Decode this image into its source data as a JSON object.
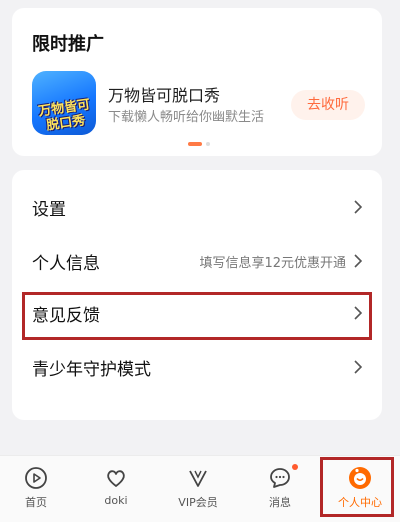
{
  "promo": {
    "title": "限时推广",
    "app_icon_text_1": "万物皆可",
    "app_icon_text_2": "脱口秀",
    "app_name": "万物皆可脱口秀",
    "app_desc": "下载懒人畅听给你幽默生活",
    "button": "去收听"
  },
  "menu": {
    "items": [
      {
        "label": "设置",
        "hint": ""
      },
      {
        "label": "个人信息",
        "hint": "填写信息享12元优惠开通"
      },
      {
        "label": "意见反馈",
        "hint": ""
      },
      {
        "label": "青少年守护模式",
        "hint": ""
      }
    ]
  },
  "tabbar": {
    "tabs": [
      {
        "label": "首页",
        "icon": "play-icon"
      },
      {
        "label": "doki",
        "icon": "heart-bubble-icon"
      },
      {
        "label": "VIP会员",
        "icon": "vip-v-icon"
      },
      {
        "label": "消息",
        "icon": "chat-bubble-icon",
        "badge": true
      },
      {
        "label": "个人中心",
        "icon": "profile-face-icon",
        "active": true
      }
    ],
    "accent": "#ff6a00"
  }
}
